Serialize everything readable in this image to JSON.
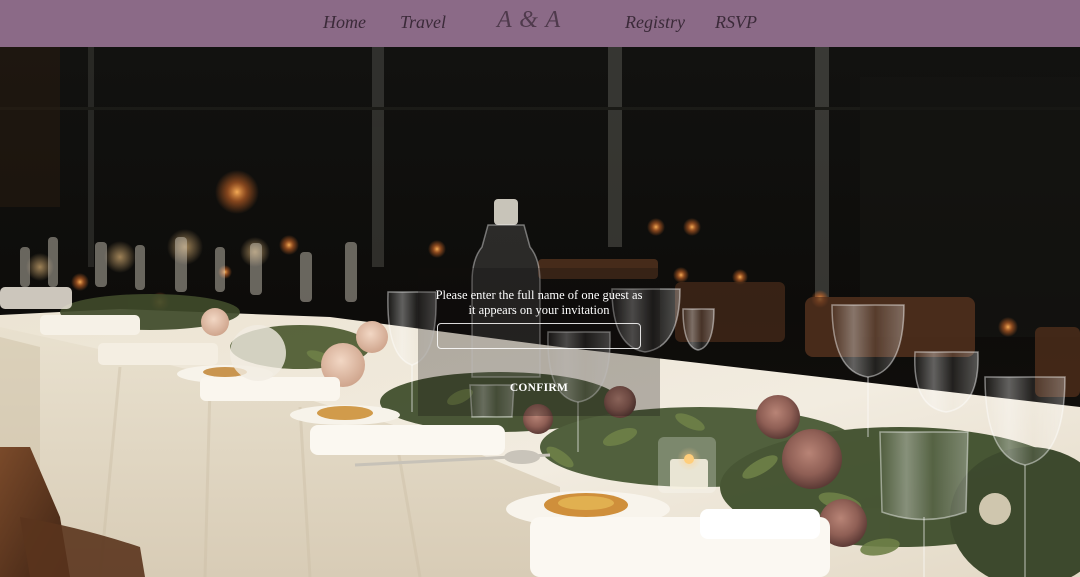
{
  "nav": {
    "home": "Home",
    "travel": "Travel",
    "monogram": "A & A",
    "registry": "Registry",
    "rsvp": "RSVP"
  },
  "dialog": {
    "prompt_line1": "Please enter the full name of one guest as",
    "prompt_line2": "it appears on your invitation",
    "input_value": "",
    "confirm_label": "CONFIRM"
  },
  "colors": {
    "nav_background": "#8b6a87",
    "nav_text": "#3b2a39"
  },
  "background": {
    "description": "wedding reception table with white linen, candles, glassware and roses"
  }
}
